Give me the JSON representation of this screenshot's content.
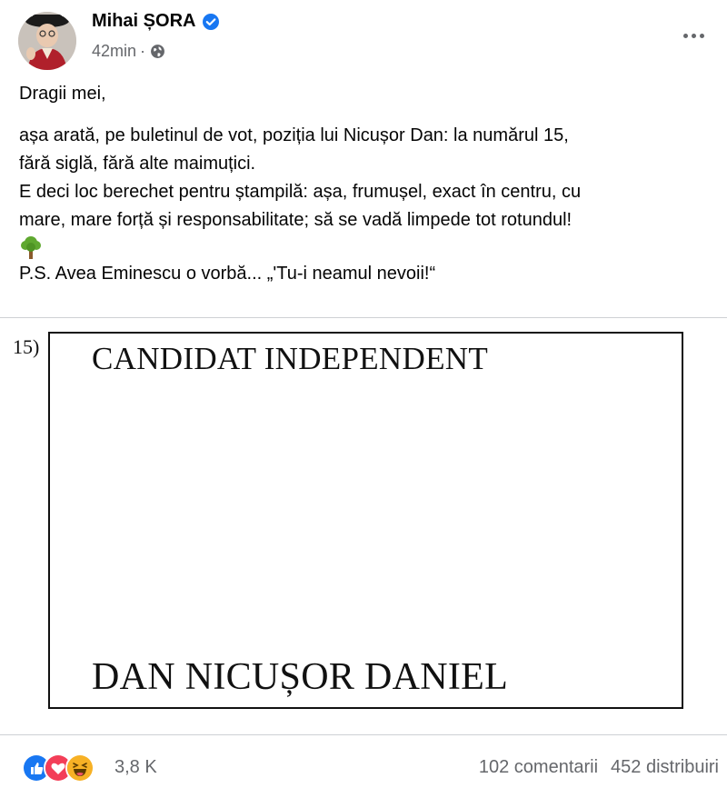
{
  "post": {
    "author": "Mihai ȘORA",
    "time": "42min",
    "meta_sep": "·",
    "icons": {
      "verified": "verified-badge-icon",
      "audience": "globe-icon",
      "options": "more-options-icon"
    },
    "colors": {
      "verified": "#1877f2",
      "meta": "#65676b"
    },
    "greeting": "Dragii mei,",
    "lines": [
      "așa arată, pe buletinul de vot, poziția lui Nicușor Dan: la numărul 15,",
      "fără siglă, fără alte maimuțici.",
      "E deci loc berechet pentru ștampilă: așa, frumușel, exact în centru, cu",
      "mare, mare forță și responsabilitate; să se vadă limpede tot rotundul!"
    ],
    "emoji": "deciduous-tree",
    "ps": "P.S. Avea Eminescu o vorbă... „'Tu-i neamul nevoii!“"
  },
  "ballot": {
    "number": "15)",
    "header": "CANDIDAT INDEPENDENT",
    "candidate": "DAN NICUȘOR DANIEL"
  },
  "footer": {
    "reaction_icons": [
      "like",
      "love",
      "haha"
    ],
    "reaction_count": "3,8 K",
    "comments": "102 comentarii",
    "shares": "452 distribuiri"
  }
}
